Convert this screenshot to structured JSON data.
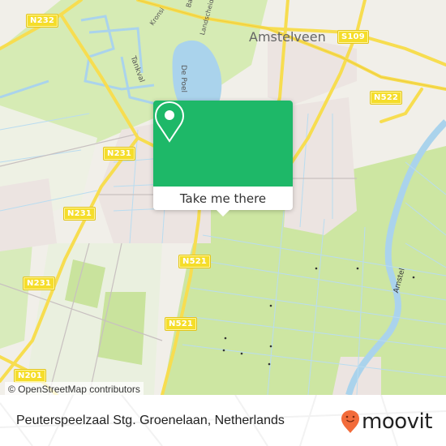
{
  "map": {
    "attribution": "© OpenStreetMap contributors",
    "city_label": "Amstelveen",
    "water_labels": {
      "lake": "De Poel",
      "river": "Amstel",
      "canal": "Tankval"
    },
    "street_labels": [
      "Kronsi",
      "Ba",
      "Landscheiding"
    ],
    "road_shields": [
      {
        "ref": "N232"
      },
      {
        "ref": "S109"
      },
      {
        "ref": "N522"
      },
      {
        "ref": "N231"
      },
      {
        "ref": "N231"
      },
      {
        "ref": "N231"
      },
      {
        "ref": "N521"
      },
      {
        "ref": "N521"
      },
      {
        "ref": "N201"
      }
    ],
    "colors": {
      "land": "#f1efe9",
      "green": "#cfe8a6",
      "water": "#aad3ec",
      "road": "#f7dd50",
      "urban": "#ece4e1"
    }
  },
  "popup": {
    "icon": "map-pin-icon",
    "button_label": "Take me there",
    "color": "#1eb868"
  },
  "footer": {
    "place_name": "Peuterspeelzaal Stg. Groenelaan, Netherlands",
    "brand": "moovit",
    "brand_color": "#f26b3a"
  }
}
